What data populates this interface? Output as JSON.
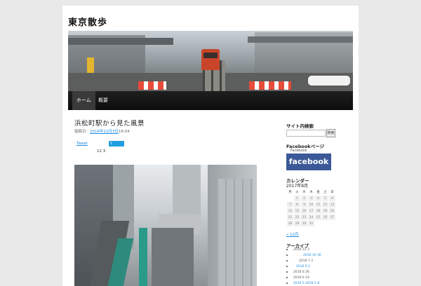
{
  "site": {
    "title": "東京散歩"
  },
  "nav": {
    "items": [
      "ホーム",
      "概要"
    ]
  },
  "post": {
    "title": "浜松町駅から見た風景",
    "meta_prefix": "投稿日：",
    "date": "2016年12月3日",
    "time": "16:04",
    "tweet_label": "Tweet",
    "like_count_label": "1",
    "like_count": "12 3"
  },
  "sidebar": {
    "search_title": "サイト内検索",
    "search_button": "検索",
    "facebook_title": "Facebookページ",
    "facebook_sub": "Facebook",
    "facebook_logo": "facebook",
    "calendar_title": "カレンダー",
    "calendar_caption": "2017年8月",
    "weekdays": [
      "月",
      "火",
      "水",
      "木",
      "金",
      "土",
      "日"
    ],
    "calendar_rows": [
      [
        "",
        "1",
        "2",
        "3",
        "4",
        "5",
        "6"
      ],
      [
        "7",
        "8",
        "9",
        "10",
        "11",
        "12",
        "13"
      ],
      [
        "14",
        "15",
        "16",
        "17",
        "18",
        "19",
        "20"
      ],
      [
        "21",
        "22",
        "23",
        "24",
        "25",
        "26",
        "27"
      ],
      [
        "28",
        "29",
        "30",
        "31",
        "",
        "",
        ""
      ]
    ],
    "prev_link": "« 12月",
    "archive_title": "アーカイブ",
    "archives": [
      {
        "label": "2016 12 3",
        "blue": false
      },
      {
        "label": "2016 10 30",
        "blue": true,
        "extra": "2016 10 30"
      },
      {
        "label": "2016 7 3",
        "blue": false
      },
      {
        "label": "2016 6 2",
        "blue": true,
        "extra": "2016 7 2"
      },
      {
        "label": "2016 6 26",
        "blue": false
      },
      {
        "label": "2016 6 19",
        "blue": false
      },
      {
        "label": "2016 5 2016 5 8",
        "blue": true
      }
    ]
  }
}
